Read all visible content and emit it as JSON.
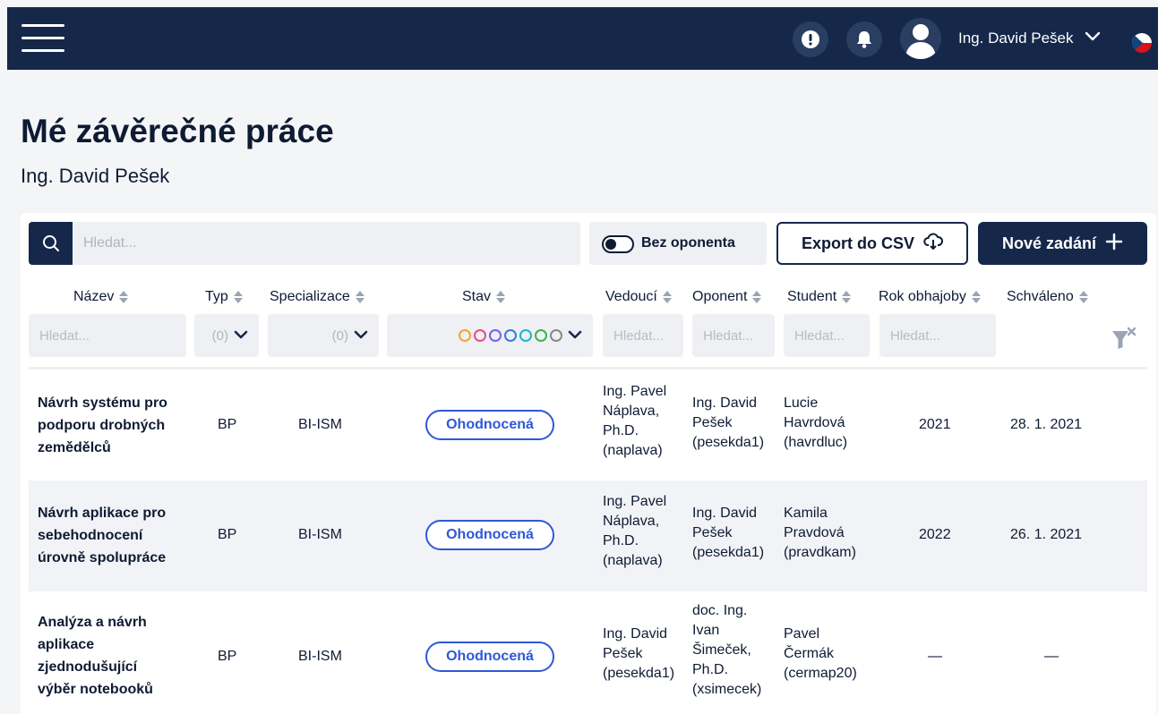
{
  "header": {
    "user_name": "Ing. David Pešek",
    "icons": [
      "menu-icon",
      "alert-icon",
      "bell-icon",
      "user-icon",
      "chevron-down-icon",
      "czech-flag-icon"
    ],
    "colors": {
      "navbar": "#15284a",
      "accent": "#2f58d6"
    }
  },
  "page": {
    "title": "Mé závěrečné práce",
    "subtitle": "Ing. David Pešek"
  },
  "toolbar": {
    "search_placeholder": "Hledat...",
    "toggle_label": "Bez oponenta",
    "export_label": "Export do CSV",
    "new_label": "Nové zadání"
  },
  "table": {
    "columns": [
      "Název",
      "Typ",
      "Specializace",
      "Stav",
      "Vedoucí",
      "Oponent",
      "Student",
      "Rok obhajoby",
      "Schváleno"
    ],
    "filters": {
      "nazev_placeholder": "Hledat...",
      "typ_value": "(0)",
      "specializace_value": "(0)",
      "vedouci_placeholder": "Hledat...",
      "oponent_placeholder": "Hledat...",
      "student_placeholder": "Hledat...",
      "rok_placeholder": "Hledat..."
    },
    "status_colors": [
      "#f5a623",
      "#e94b8a",
      "#7b5cf0",
      "#2f7de1",
      "#1fb5c9",
      "#3bb54a",
      "#888888"
    ],
    "rows": [
      {
        "title": [
          "Návrh systému pro",
          "podporu drobných",
          "zemědělců"
        ],
        "typ": "BP",
        "specializace": "BI-ISM",
        "stav": "Ohodnocená",
        "vedouci": [
          "Ing. Pavel",
          "Náplava,",
          "Ph.D.",
          "(naplava)"
        ],
        "oponent": [
          "Ing. David",
          "Pešek",
          "(pesekda1)"
        ],
        "student": [
          "Lucie",
          "Havrdová",
          "(havrdluc)"
        ],
        "rok": "2021",
        "schvaleno": "28. 1. 2021"
      },
      {
        "title": [
          "Návrh aplikace pro",
          "sebehodnocení",
          "úrovně spolupráce"
        ],
        "typ": "BP",
        "specializace": "BI-ISM",
        "stav": "Ohodnocená",
        "vedouci": [
          "Ing. Pavel",
          "Náplava,",
          "Ph.D.",
          "(naplava)"
        ],
        "oponent": [
          "Ing. David",
          "Pešek",
          "(pesekda1)"
        ],
        "student": [
          "Kamila",
          "Pravdová",
          "(pravdkam)"
        ],
        "rok": "2022",
        "schvaleno": "26. 1. 2021"
      },
      {
        "title": [
          "Analýza a návrh",
          "aplikace",
          "zjednodušující",
          "výběr notebooků"
        ],
        "typ": "BP",
        "specializace": "BI-ISM",
        "stav": "Ohodnocená",
        "vedouci": [
          "Ing. David",
          "Pešek",
          "(pesekda1)"
        ],
        "oponent": [
          "doc. Ing.",
          "Ivan",
          "Šimeček,",
          "Ph.D.",
          "(xsimecek)"
        ],
        "student": [
          "Pavel",
          "Čermák",
          "(cermap20)"
        ],
        "rok": "—",
        "schvaleno": "—"
      }
    ]
  }
}
